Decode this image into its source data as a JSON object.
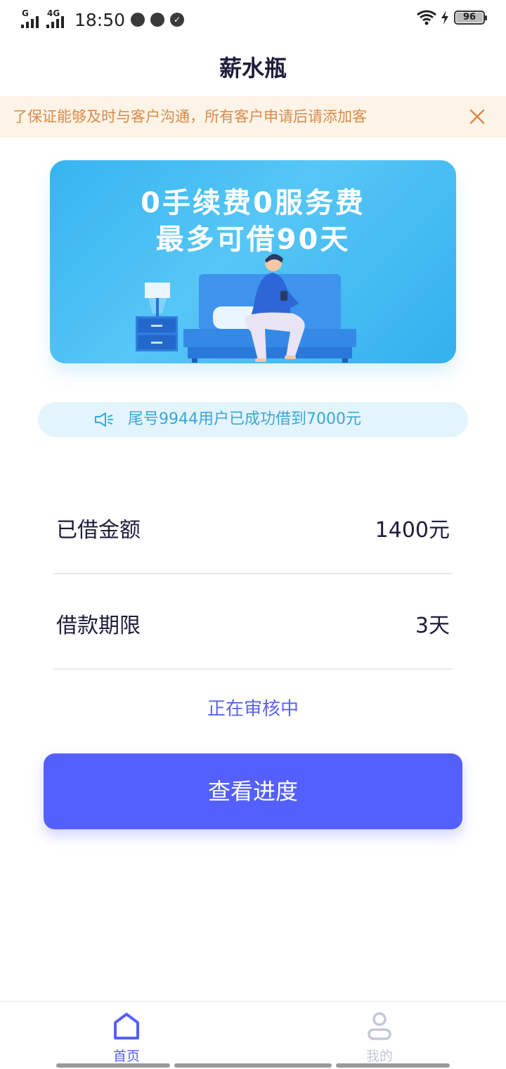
{
  "status_bar": {
    "sig1_tag": "G",
    "sig2_tag": "4G",
    "time": "18:50",
    "battery": "96",
    "battery_level": 0.96
  },
  "header": {
    "title": "薪水瓶"
  },
  "notice": {
    "text": "了保证能够及时与客户沟通，所有客户申请后请添加客"
  },
  "banner": {
    "line1": "0手续费0服务费",
    "line2": "最多可借90天"
  },
  "broadcast": {
    "text": "尾号9944用户已成功借到7000元"
  },
  "loan_info": {
    "amount_label": "已借金额",
    "amount_value": "1400元",
    "term_label": "借款期限",
    "term_value": "3天"
  },
  "review_status": "正在审核中",
  "action": {
    "button_label": "查看进度"
  },
  "tabbar": {
    "home_label": "首页",
    "mine_label": "我的"
  },
  "colors": {
    "accent": "#5460fe",
    "notice_bg": "#fdf3e6",
    "notice_text": "#d98a4a",
    "banner_blue": "#36b4f0",
    "broadcast_text": "#3aa6d6"
  }
}
